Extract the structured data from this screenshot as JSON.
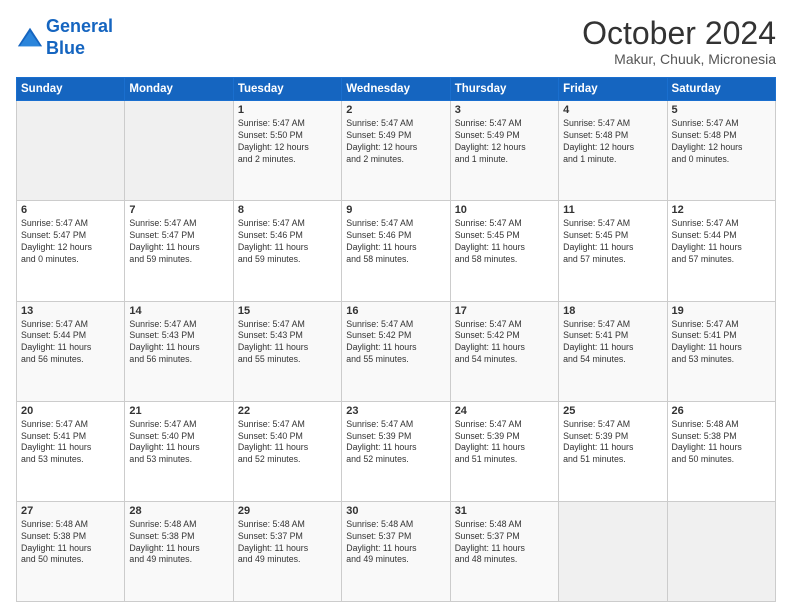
{
  "header": {
    "logo_line1": "General",
    "logo_line2": "Blue",
    "month_title": "October 2024",
    "location": "Makur, Chuuk, Micronesia"
  },
  "weekdays": [
    "Sunday",
    "Monday",
    "Tuesday",
    "Wednesday",
    "Thursday",
    "Friday",
    "Saturday"
  ],
  "weeks": [
    [
      {
        "day": "",
        "info": ""
      },
      {
        "day": "",
        "info": ""
      },
      {
        "day": "1",
        "info": "Sunrise: 5:47 AM\nSunset: 5:50 PM\nDaylight: 12 hours\nand 2 minutes."
      },
      {
        "day": "2",
        "info": "Sunrise: 5:47 AM\nSunset: 5:49 PM\nDaylight: 12 hours\nand 2 minutes."
      },
      {
        "day": "3",
        "info": "Sunrise: 5:47 AM\nSunset: 5:49 PM\nDaylight: 12 hours\nand 1 minute."
      },
      {
        "day": "4",
        "info": "Sunrise: 5:47 AM\nSunset: 5:48 PM\nDaylight: 12 hours\nand 1 minute."
      },
      {
        "day": "5",
        "info": "Sunrise: 5:47 AM\nSunset: 5:48 PM\nDaylight: 12 hours\nand 0 minutes."
      }
    ],
    [
      {
        "day": "6",
        "info": "Sunrise: 5:47 AM\nSunset: 5:47 PM\nDaylight: 12 hours\nand 0 minutes."
      },
      {
        "day": "7",
        "info": "Sunrise: 5:47 AM\nSunset: 5:47 PM\nDaylight: 11 hours\nand 59 minutes."
      },
      {
        "day": "8",
        "info": "Sunrise: 5:47 AM\nSunset: 5:46 PM\nDaylight: 11 hours\nand 59 minutes."
      },
      {
        "day": "9",
        "info": "Sunrise: 5:47 AM\nSunset: 5:46 PM\nDaylight: 11 hours\nand 58 minutes."
      },
      {
        "day": "10",
        "info": "Sunrise: 5:47 AM\nSunset: 5:45 PM\nDaylight: 11 hours\nand 58 minutes."
      },
      {
        "day": "11",
        "info": "Sunrise: 5:47 AM\nSunset: 5:45 PM\nDaylight: 11 hours\nand 57 minutes."
      },
      {
        "day": "12",
        "info": "Sunrise: 5:47 AM\nSunset: 5:44 PM\nDaylight: 11 hours\nand 57 minutes."
      }
    ],
    [
      {
        "day": "13",
        "info": "Sunrise: 5:47 AM\nSunset: 5:44 PM\nDaylight: 11 hours\nand 56 minutes."
      },
      {
        "day": "14",
        "info": "Sunrise: 5:47 AM\nSunset: 5:43 PM\nDaylight: 11 hours\nand 56 minutes."
      },
      {
        "day": "15",
        "info": "Sunrise: 5:47 AM\nSunset: 5:43 PM\nDaylight: 11 hours\nand 55 minutes."
      },
      {
        "day": "16",
        "info": "Sunrise: 5:47 AM\nSunset: 5:42 PM\nDaylight: 11 hours\nand 55 minutes."
      },
      {
        "day": "17",
        "info": "Sunrise: 5:47 AM\nSunset: 5:42 PM\nDaylight: 11 hours\nand 54 minutes."
      },
      {
        "day": "18",
        "info": "Sunrise: 5:47 AM\nSunset: 5:41 PM\nDaylight: 11 hours\nand 54 minutes."
      },
      {
        "day": "19",
        "info": "Sunrise: 5:47 AM\nSunset: 5:41 PM\nDaylight: 11 hours\nand 53 minutes."
      }
    ],
    [
      {
        "day": "20",
        "info": "Sunrise: 5:47 AM\nSunset: 5:41 PM\nDaylight: 11 hours\nand 53 minutes."
      },
      {
        "day": "21",
        "info": "Sunrise: 5:47 AM\nSunset: 5:40 PM\nDaylight: 11 hours\nand 53 minutes."
      },
      {
        "day": "22",
        "info": "Sunrise: 5:47 AM\nSunset: 5:40 PM\nDaylight: 11 hours\nand 52 minutes."
      },
      {
        "day": "23",
        "info": "Sunrise: 5:47 AM\nSunset: 5:39 PM\nDaylight: 11 hours\nand 52 minutes."
      },
      {
        "day": "24",
        "info": "Sunrise: 5:47 AM\nSunset: 5:39 PM\nDaylight: 11 hours\nand 51 minutes."
      },
      {
        "day": "25",
        "info": "Sunrise: 5:47 AM\nSunset: 5:39 PM\nDaylight: 11 hours\nand 51 minutes."
      },
      {
        "day": "26",
        "info": "Sunrise: 5:48 AM\nSunset: 5:38 PM\nDaylight: 11 hours\nand 50 minutes."
      }
    ],
    [
      {
        "day": "27",
        "info": "Sunrise: 5:48 AM\nSunset: 5:38 PM\nDaylight: 11 hours\nand 50 minutes."
      },
      {
        "day": "28",
        "info": "Sunrise: 5:48 AM\nSunset: 5:38 PM\nDaylight: 11 hours\nand 49 minutes."
      },
      {
        "day": "29",
        "info": "Sunrise: 5:48 AM\nSunset: 5:37 PM\nDaylight: 11 hours\nand 49 minutes."
      },
      {
        "day": "30",
        "info": "Sunrise: 5:48 AM\nSunset: 5:37 PM\nDaylight: 11 hours\nand 49 minutes."
      },
      {
        "day": "31",
        "info": "Sunrise: 5:48 AM\nSunset: 5:37 PM\nDaylight: 11 hours\nand 48 minutes."
      },
      {
        "day": "",
        "info": ""
      },
      {
        "day": "",
        "info": ""
      }
    ]
  ]
}
